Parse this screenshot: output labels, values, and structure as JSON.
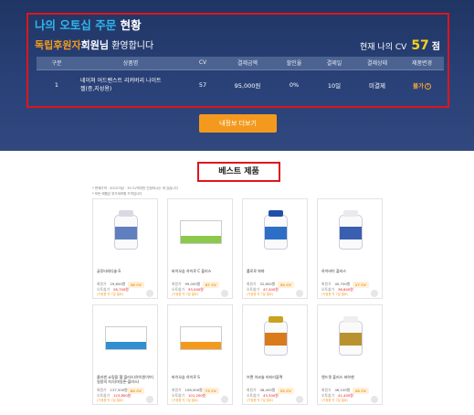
{
  "order_section": {
    "title_part1": "나의 오토십 주문",
    "title_part2": " 현황",
    "member_type": "독립후원자",
    "member_suffix": "회원님",
    "welcome": " 환영합니다",
    "cv_label": "현재 나의 CV",
    "cv_value": "57",
    "cv_unit": "점",
    "table_headers": [
      "구분",
      "상품명",
      "CV",
      "결제금액",
      "할인율",
      "결제일",
      "결제상태",
      "제품변경"
    ],
    "rows": [
      {
        "no": "1",
        "product_line1": "네이쳐 어드밴스트 리커버리 나이트",
        "product_line2": "젤(증,지성용)",
        "cv": "57",
        "amount": "95,000원",
        "discount": "0%",
        "pay_day": "10일",
        "status": "미결제",
        "change_label": "불가"
      }
    ],
    "more_button": "내정보 더보기"
  },
  "best_section": {
    "title": "베스트 제품",
    "note1": "* 판매가격 : 30CV이상 · 30 CV까지만 인정하시는 게 있습니다",
    "note2": "* 모든 제품은 부가세포함 가격입니다",
    "price_label": "회원가",
    "auto_label": "오토쉽가",
    "products": [
      {
        "name": "글루타레디솔-S",
        "price": "29,600원",
        "auto_price": "26,700원",
        "extra": "(가정용 약 7일 필요)",
        "cv": "28 CV",
        "type": "bottle",
        "cap": "#d9d9e3",
        "label": "#5f7fbf"
      },
      {
        "name": "바이오숨 하이로 C 플러스",
        "price": "99,000원",
        "auto_price": "93,000원",
        "extra": "(가정용 약 7일 필요)",
        "cv": "67 CV",
        "type": "box",
        "stripe": "#8cc84b"
      },
      {
        "name": "롤로로 파파",
        "price": "52,800원",
        "auto_price": "47,400원",
        "extra": "(가정용 약 7일 필요)",
        "cv": "30 CV",
        "type": "bottle",
        "cap": "#1f4fa8",
        "label": "#2d6fc7"
      },
      {
        "name": "하이바이 플러스",
        "price": "40,700원",
        "auto_price": "36,600원",
        "extra": "(가정용 약 7일 필요)",
        "cv": "27 CV",
        "type": "bottle",
        "cap": "#e9e9ee",
        "label": "#3a5fb0"
      },
      {
        "name": "콜라겐 쇼핑을 헬 플러스(하이원이브)\n일용의 지식(마일론-플러스)",
        "price": "137,500원",
        "auto_price": "123,800원",
        "extra": "(가정용 약 7일 필요)",
        "cv": "84 CV",
        "type": "box",
        "stripe": "#2f8fd0"
      },
      {
        "name": "바이오숨 하이로 S",
        "price": "108,900원",
        "auto_price": "101,200원",
        "extra": "(가정용 약 7일 필요)",
        "cv": "73 CV",
        "type": "box",
        "stripe": "#f39a1e"
      },
      {
        "name": "브랜 아코솔 비타리플렉",
        "price": "48,400원",
        "auto_price": "43,300원",
        "extra": "(가정용 약 7일 필요)",
        "cv": "32 CV",
        "type": "bottle",
        "cap": "#c9a21e",
        "label": "#d97a1b"
      },
      {
        "name": "엔드핏 플러스 바하젠",
        "price": "46,100원",
        "auto_price": "41,400원",
        "extra": "(가정용 약 7일 필요)",
        "cv": "28 CV",
        "type": "bottle",
        "cap": "#eeeeee",
        "label": "#b8922f"
      }
    ]
  }
}
